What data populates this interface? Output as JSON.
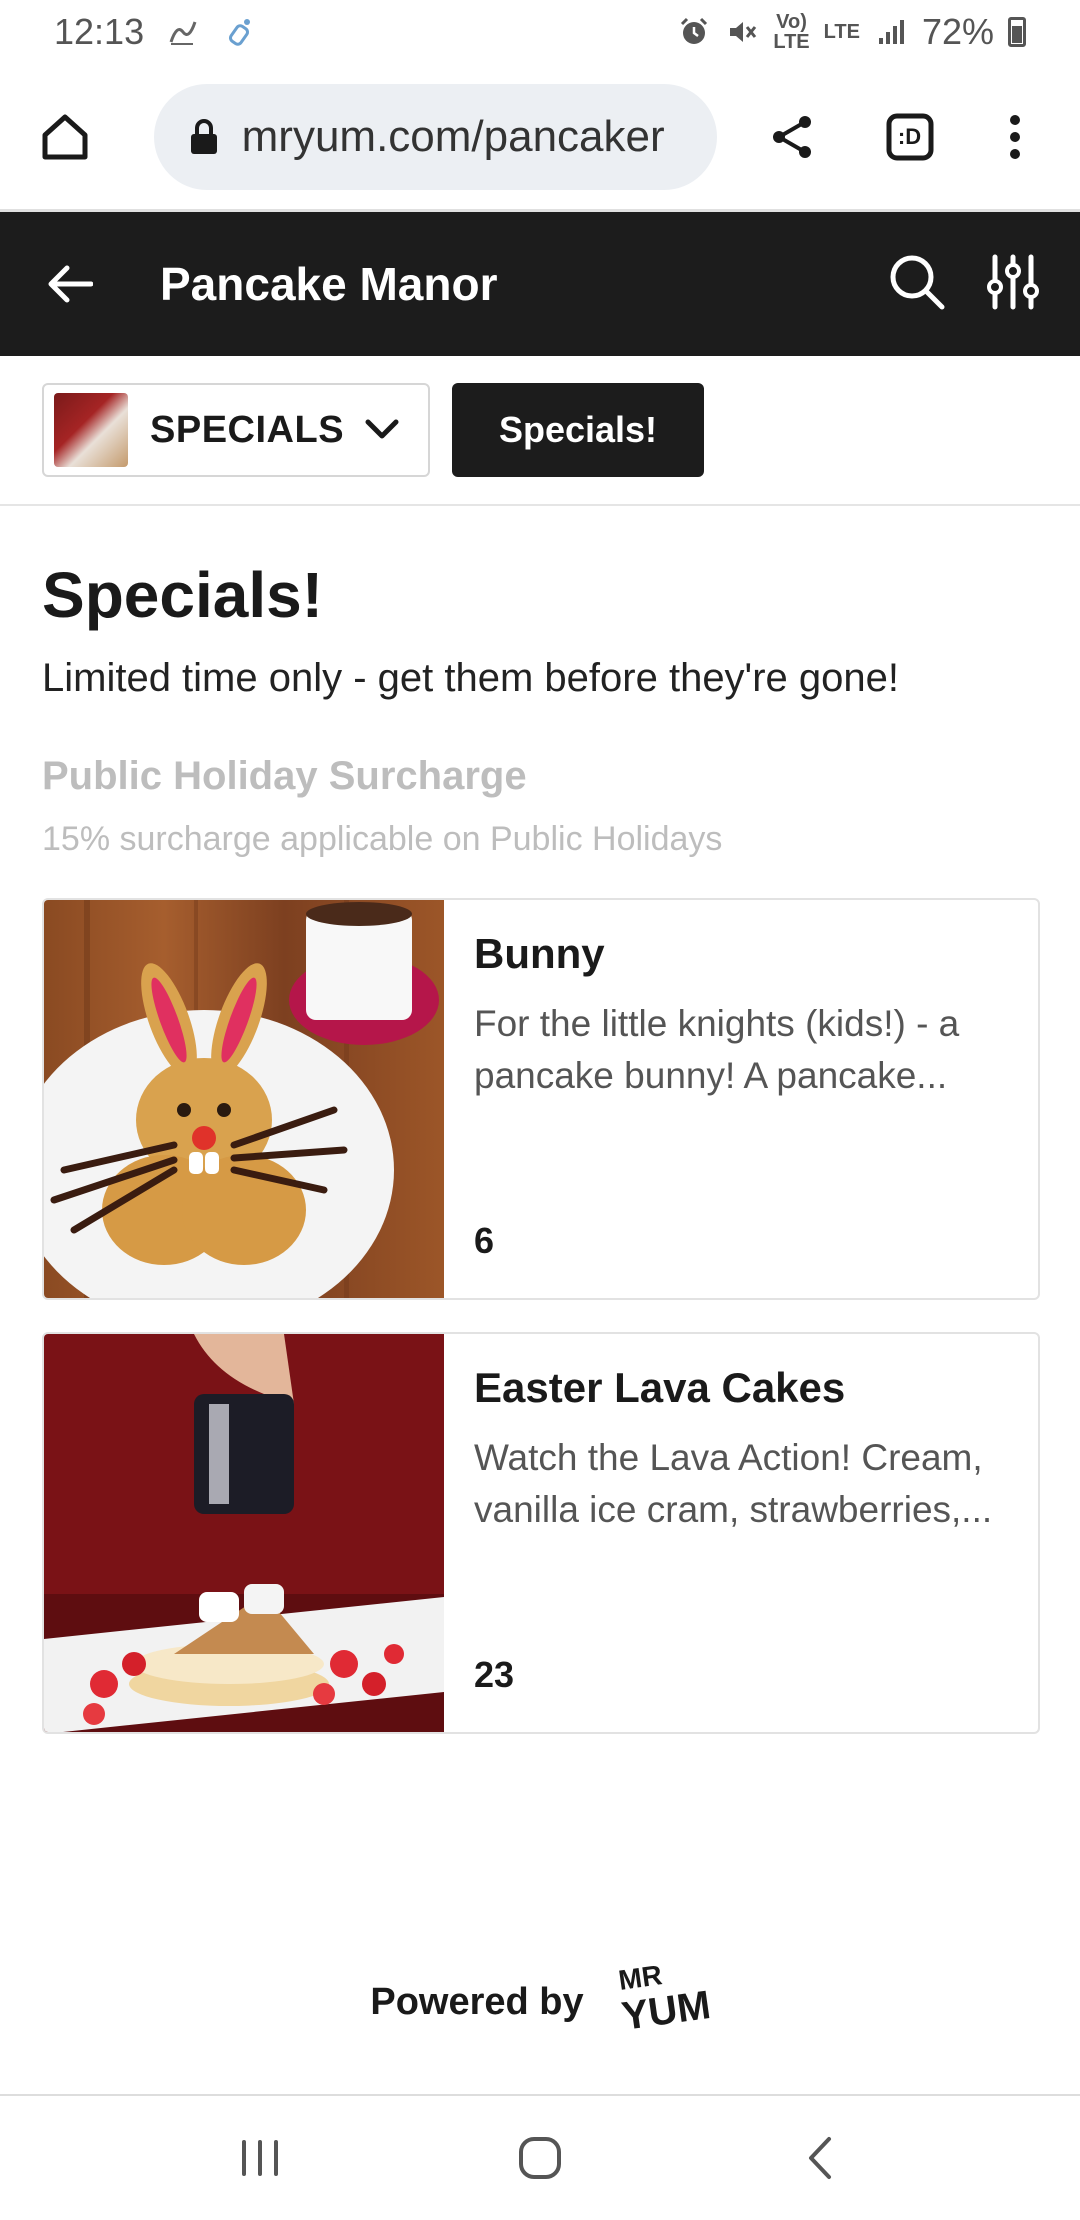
{
  "status_bar": {
    "time": "12:13",
    "battery": "72%",
    "volte": "Vo)\nLTE",
    "lte": "LTE"
  },
  "browser": {
    "url": "mryum.com/pancaker",
    "tab_glyph": ":D"
  },
  "header": {
    "title": "Pancake Manor"
  },
  "category_bar": {
    "selected": "SPECIALS",
    "pill": "Specials!"
  },
  "section": {
    "title": "Specials!",
    "description": "Limited time only - get them before they're gone!",
    "notice_title": "Public Holiday Surcharge",
    "notice_text": "15% surcharge applicable on Public Holidays"
  },
  "items": [
    {
      "name": "Bunny",
      "description": "For the little knights (kids!) - a pancake bunny! A pancake...",
      "price": "6"
    },
    {
      "name": "Easter Lava Cakes",
      "description": "Watch the Lava Action! Cream, vanilla ice cram, strawberries,...",
      "price": "23"
    }
  ],
  "footer": {
    "powered_by": "Powered by",
    "logo_top": "MR",
    "logo_bottom": "YUM"
  },
  "colors": {
    "header_bg": "#1c1c1c",
    "muted_text": "#bdbdbd",
    "url_pill_bg": "#eceff3"
  }
}
